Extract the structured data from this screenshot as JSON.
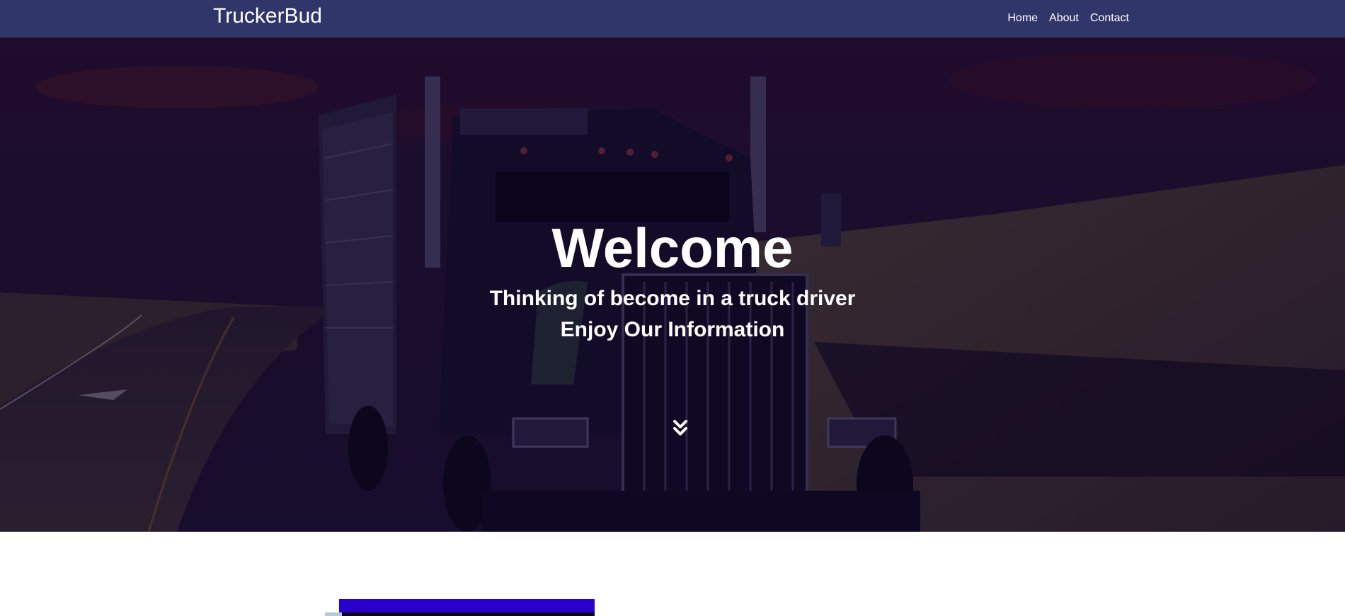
{
  "navbar": {
    "brand": "TruckerBud",
    "links": [
      "Home",
      "About",
      "Contact"
    ]
  },
  "hero": {
    "title": "Welcome",
    "subtitle_line1": "Thinking of become in a truck driver",
    "subtitle_line2": "Enjoy Our Information",
    "scroll_icon": "double-chevron-down-icon"
  },
  "colors": {
    "navbar_bg": "#30356a",
    "hero_overlay": "#1a0d30",
    "accent_block": "#2a00cc",
    "text": "#ffffff"
  }
}
